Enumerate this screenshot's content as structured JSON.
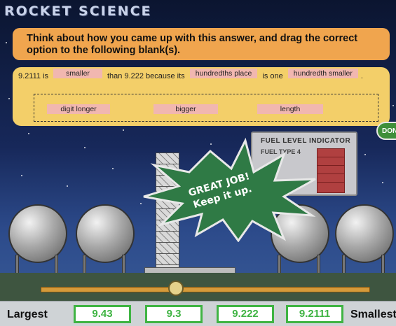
{
  "game": {
    "title": "ROCKET SCIENCE"
  },
  "prompt": {
    "text": "Think about how you came up with this answer, and drag the correct option to the following blank(s)."
  },
  "sentence": {
    "part1": "9.2111 is",
    "blank1": "smaller",
    "part2": "than 9.222 because its",
    "blank2": "hundredths place",
    "part3": "is one",
    "blank3": "hundredth smaller",
    "part4": "."
  },
  "options": [
    "digit longer",
    "bigger",
    "length"
  ],
  "done_button": {
    "label": "DONE"
  },
  "fuel_indicator": {
    "title": "FUEL LEVEL INDICATOR",
    "type_label": "FUEL TYPE 4"
  },
  "feedback": {
    "line1": "GREAT JOB!",
    "line2": "Keep it up."
  },
  "ordering": {
    "left_label": "Largest",
    "right_label": "Smallest",
    "values": [
      "9.43",
      "9.3",
      "9.222",
      "9.2111"
    ]
  },
  "colors": {
    "prompt_bg": "#f0a54e",
    "panel_bg": "#f3cf69",
    "chip_bg": "#f1b7b0",
    "burst_green": "#2f7a45",
    "value_green": "#3fb443"
  }
}
